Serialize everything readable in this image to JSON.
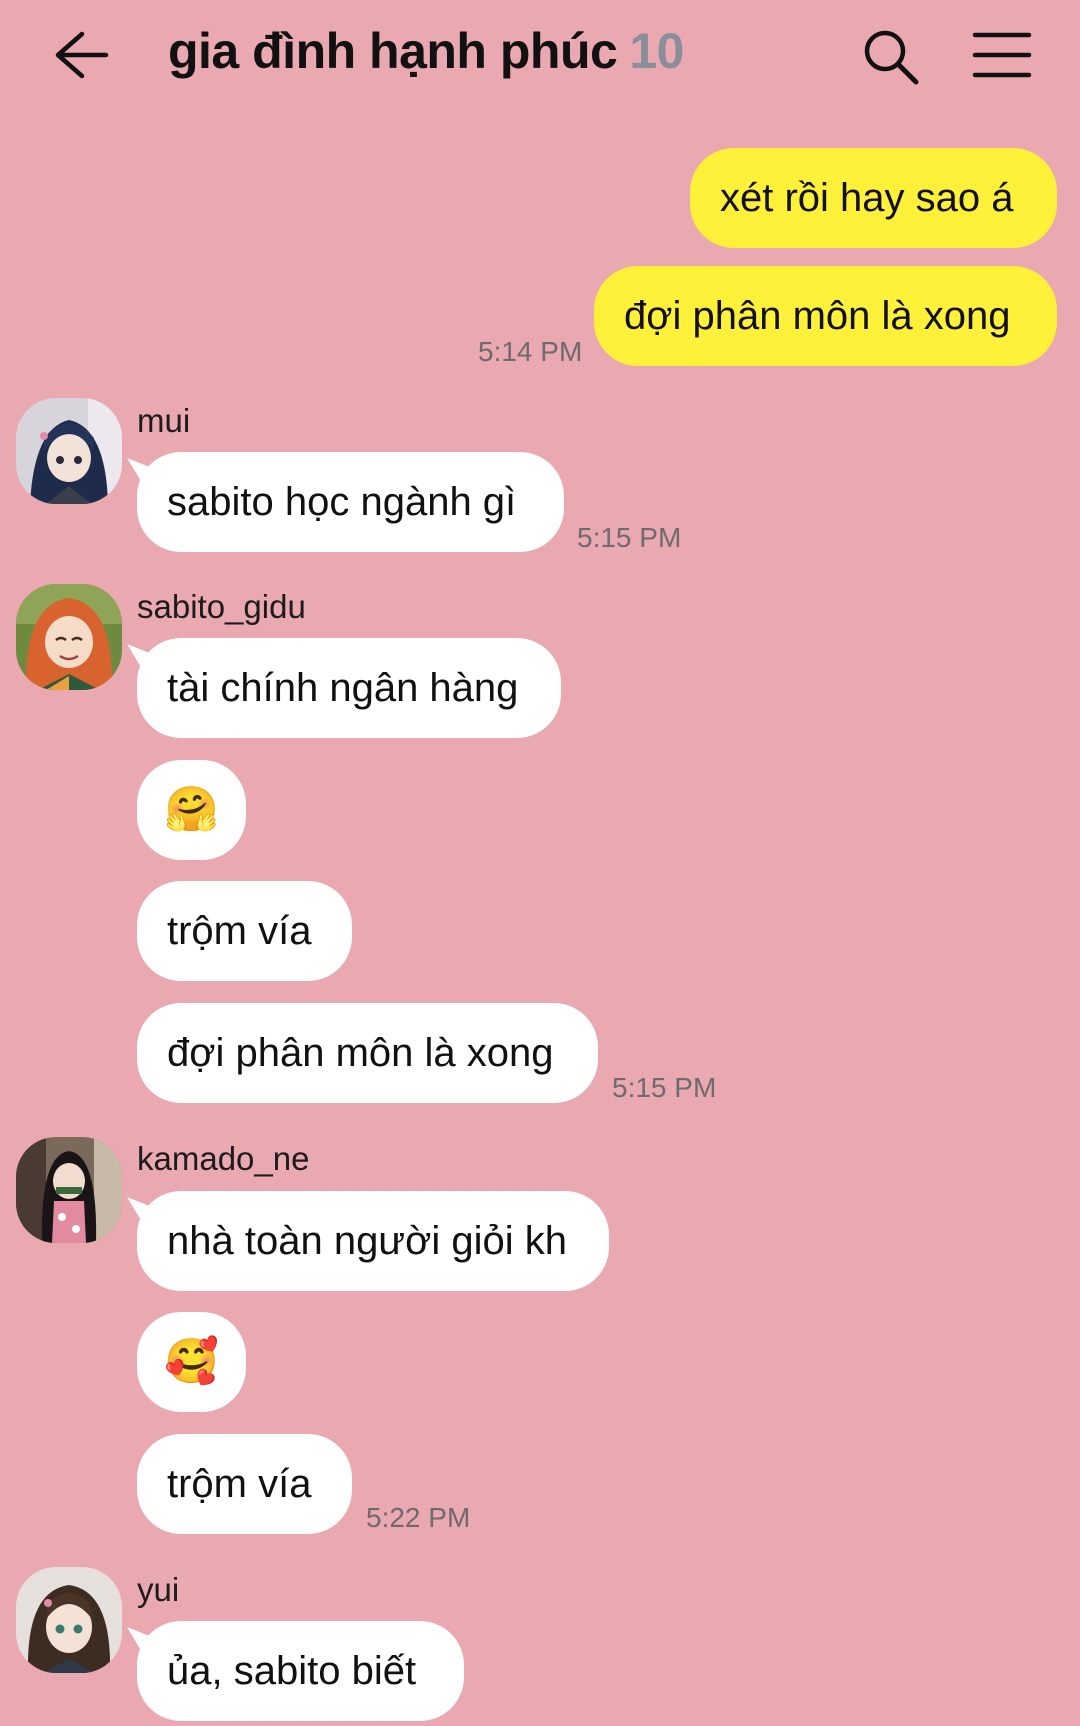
{
  "header": {
    "title": "gia đình hạnh phúc",
    "member_count": "10"
  },
  "messages": {
    "m1": "xét rồi hay sao á",
    "m2": "đợi phân môn là xong",
    "t1": "5:14 PM",
    "sender_mui": "mui",
    "m3": "sabito học ngành gì",
    "t2": "5:15 PM",
    "sender_sabito": "sabito_gidu",
    "m4": "tài chính ngân hàng",
    "m5": "🤗",
    "m6": "trộm vía",
    "m7": "đợi phân môn là xong",
    "t3": "5:15 PM",
    "sender_kamado": "kamado_ne",
    "m8": "nhà toàn người giỏi kh",
    "m9": "🥰",
    "m10": "trộm vía",
    "t4": "5:22 PM",
    "sender_yui": "yui",
    "m11": "ủa, sabito biết"
  },
  "colors": {
    "background": "#eaa8b0",
    "own_bubble": "#fff03a",
    "other_bubble": "#ffffff",
    "count_gray": "#8a8e9a"
  }
}
